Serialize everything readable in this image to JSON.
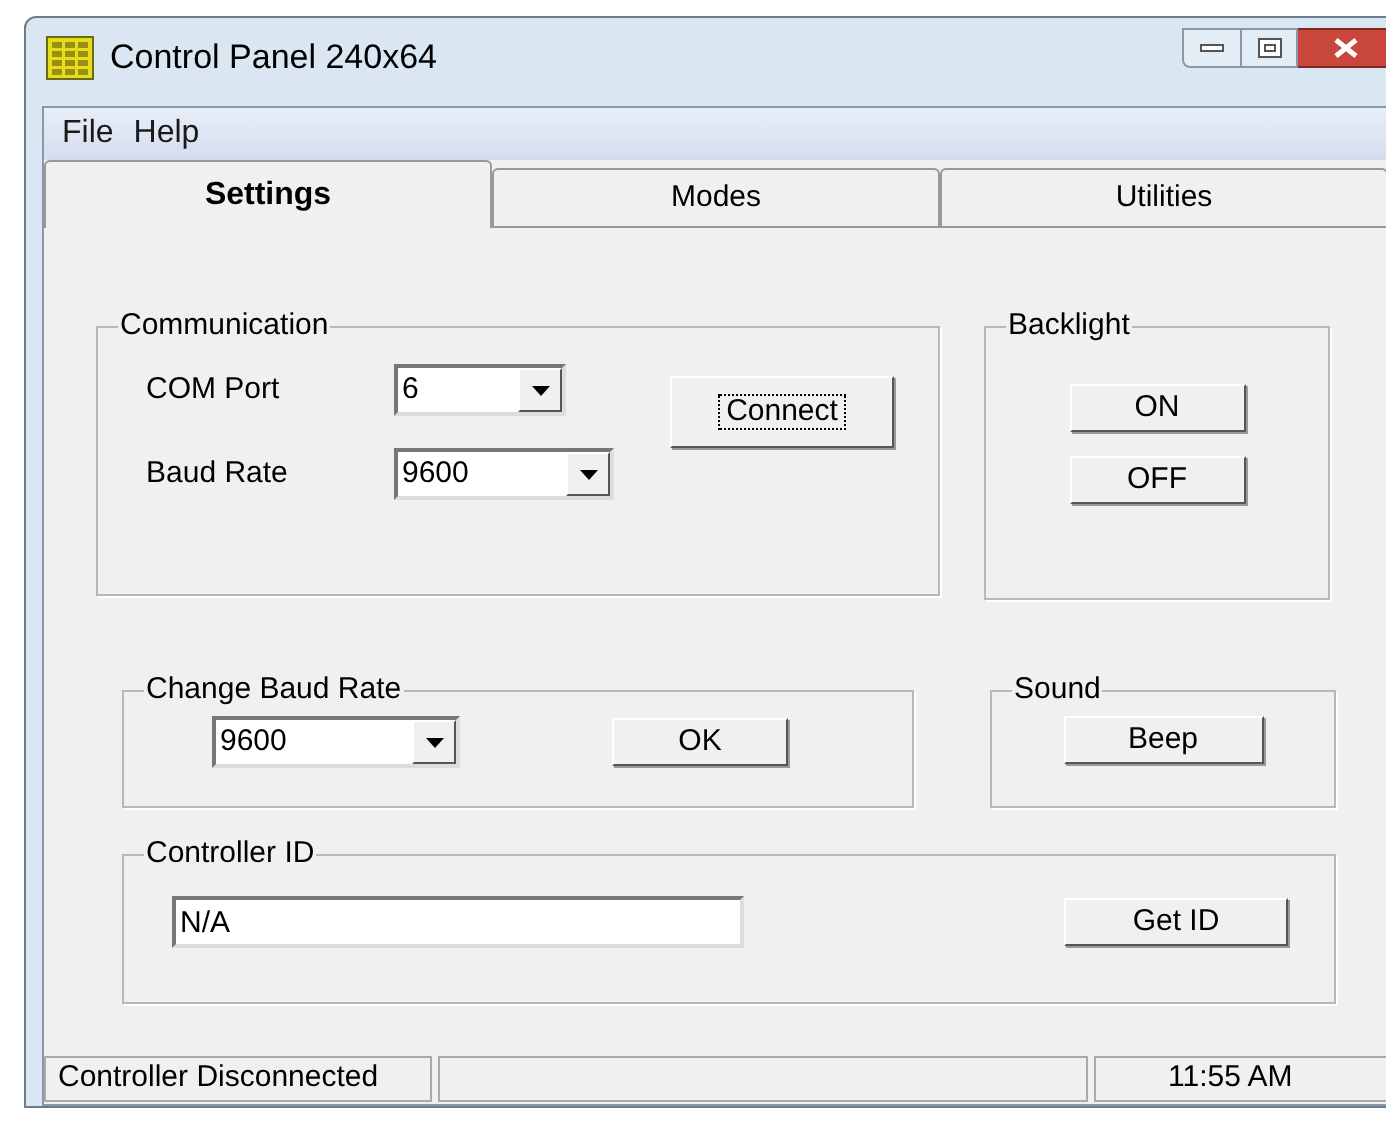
{
  "window": {
    "title": "Control Panel 240x64"
  },
  "menu": [
    "File",
    "Help"
  ],
  "tabs": [
    {
      "label": "Settings",
      "selected": true
    },
    {
      "label": "Modes",
      "selected": false
    },
    {
      "label": "Utilities",
      "selected": false
    }
  ],
  "communication": {
    "title": "Communication",
    "com_port": {
      "label": "COM Port",
      "value": "6"
    },
    "baud_rate": {
      "label": "Baud Rate",
      "value": "9600"
    },
    "connect_button": "Connect"
  },
  "backlight": {
    "title": "Backlight",
    "buttons": [
      "ON",
      "OFF"
    ]
  },
  "change_baud_rate": {
    "title": "Change Baud Rate",
    "value": "9600",
    "ok_button": "OK"
  },
  "sound": {
    "title": "Sound",
    "button": "Beep"
  },
  "controller_id": {
    "title": "Controller ID",
    "value": "N/A",
    "button": "Get ID"
  },
  "status_bar": {
    "status": "Controller Disconnected",
    "time": "11:55 AM"
  }
}
